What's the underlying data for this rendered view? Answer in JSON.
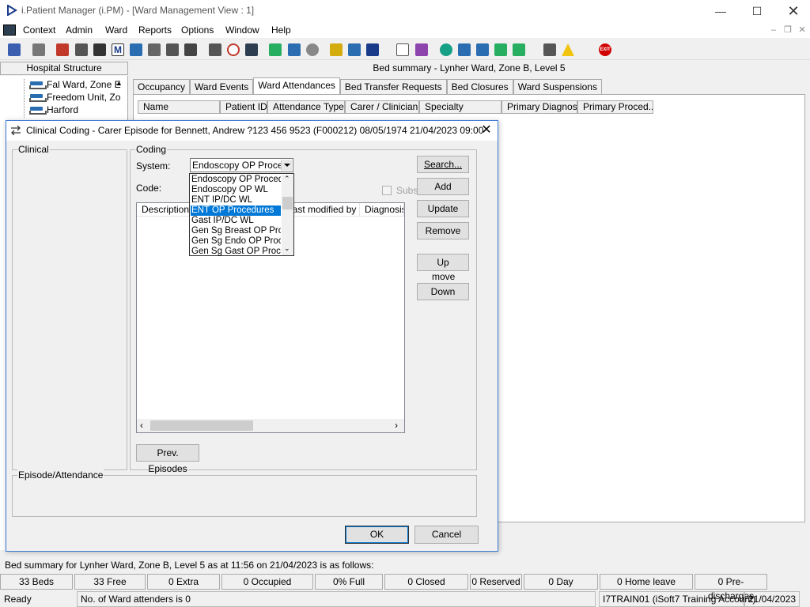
{
  "window": {
    "title": "i.Patient Manager (i.PM) - [Ward Management View : 1]"
  },
  "menu": {
    "items": [
      "Context",
      "Admin",
      "Ward",
      "Reports",
      "Options",
      "Window",
      "Help"
    ]
  },
  "left_panel": {
    "header": "Hospital Structure",
    "tree_items": [
      "Fal Ward, Zone E",
      "Freedom Unit, Zo",
      "Harford"
    ]
  },
  "bed_summary_title": "Bed summary - Lynher Ward, Zone B, Level 5",
  "tabs": [
    "Occupancy",
    "Ward Events",
    "Ward Attendances",
    "Bed Transfer Requests",
    "Bed Closures",
    "Ward Suspensions"
  ],
  "active_tab": "Ward Attendances",
  "grid_columns": [
    "Name",
    "Patient ID",
    "Attendance Type",
    "Carer / Clinician",
    "Specialty",
    "Primary Diagnosis",
    "Primary Proced..."
  ],
  "dialog": {
    "title": "Clinical Coding - Carer Episode for Bennett, Andrew ?123 456 9523 (F000212) 08/05/1974 21/04/2023 09:00",
    "clinical_label": "Clinical",
    "coding_label": "Coding",
    "system_label": "System:",
    "system_value": "Endoscopy OP Proced",
    "code_label": "Code:",
    "subs_label": "Subs",
    "dropdown_options": [
      "Endoscopy OP Procedu",
      "Endoscopy OP WL",
      "ENT IP/DC WL",
      "ENT OP Procedures",
      "Gast IP/DC WL",
      "Gen Sg Breast OP Proc",
      "Gen Sg Endo OP Proce",
      "Gen Sg Gast OP Proce"
    ],
    "dropdown_selected": "ENT OP Procedures",
    "list_columns": [
      "Description",
      "Last modified by",
      "Diagnosis"
    ],
    "buttons": {
      "search": "Search...",
      "add": "Add",
      "update": "Update",
      "remove": "Remove",
      "up": "Up",
      "move": "move",
      "down": "Down",
      "prev_episodes": "Prev. Episodes",
      "ok": "OK",
      "cancel": "Cancel"
    },
    "episode_label": "Episode/Attendance"
  },
  "status": {
    "summary_text": "Bed summary for Lynher Ward, Zone B, Level 5 as at 11:56 on 21/04/2023 is as follows:",
    "cells": [
      "33 Beds",
      "33 Free",
      "0 Extra",
      "0 Occupied",
      "0% Full",
      "0 Closed",
      "0 Reserved",
      "0 Day",
      "0 Home leave",
      "0 Pre-discharges"
    ],
    "ready": "Ready",
    "ward_attenders": "No. of Ward attenders is 0",
    "account": "I7TRAIN01 (iSoft7 Training Account)",
    "date": "21/04/2023"
  }
}
